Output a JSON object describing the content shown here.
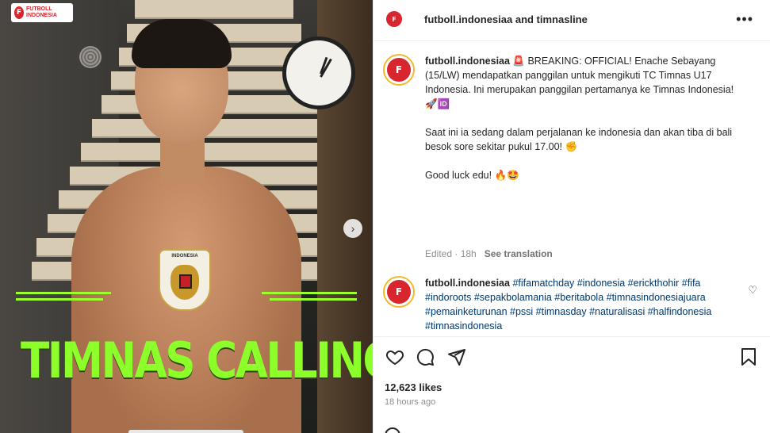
{
  "media": {
    "brand_logo_text": "FUTBOLL INDONESIA",
    "crest_label": "INDONESIA",
    "headline": "TIMNAS CALLING",
    "next_icon": "chevron-right-icon"
  },
  "post": {
    "header": {
      "title": "futboll.indonesiaa and timnasline",
      "more_icon": "more-horizontal-icon"
    },
    "caption": {
      "username": "futboll.indonesiaa",
      "paragraph1": " 🚨 BREAKING: OFFICIAL! Enache Sebayang (15/LW) mendapatkan panggilan untuk mengikuti TC Timnas U17 Indonesia. Ini merupakan panggilan pertamanya ke Timnas Indonesia! 🚀🆔",
      "paragraph2": "Saat ini ia sedang dalam perjalanan ke indonesia dan akan tiba di bali besok sore sekitar pukul 17.00! ✊",
      "paragraph3": "Good luck edu! 🔥🤩"
    },
    "meta": {
      "edited": "Edited · 18h",
      "see_translation": "See translation"
    },
    "hashtag_comment": {
      "username": "futboll.indonesiaa",
      "tags": "#fifamatchday #indonesia #erickthohir #fifa #indoroots #sepakbolamania #beritabola #timnasindonesiajuara #pemainketurunan #pssi #timnasday #naturalisasi #halfindonesia #timnasindonesia"
    },
    "actions": {
      "like_icon": "heart-icon",
      "comment_icon": "comment-icon",
      "share_icon": "send-icon",
      "save_icon": "bookmark-icon"
    },
    "likes": "12,623 likes",
    "time_ago": "18 hours ago"
  }
}
